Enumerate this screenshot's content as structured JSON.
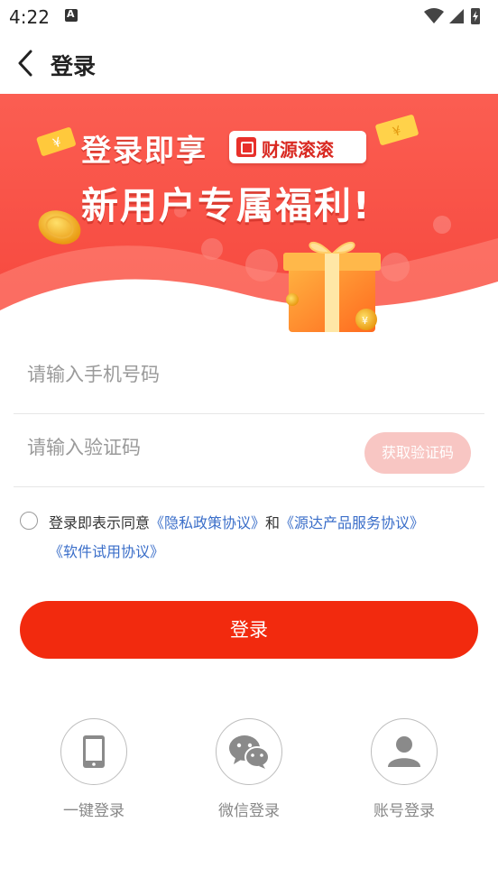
{
  "status_bar": {
    "time": "4:22",
    "icons": [
      "notification-a-icon",
      "wifi-icon",
      "signal-icon",
      "battery-charging-icon"
    ]
  },
  "header": {
    "back_icon": "chevron-left-icon",
    "title": "登录"
  },
  "banner": {
    "line1": "登录即享",
    "brand": "财源滚滚",
    "line2": "新用户专属福利!",
    "colors": {
      "top": "#fb5a4f",
      "bottom": "#f7443c"
    }
  },
  "form": {
    "phone_placeholder": "请输入手机号码",
    "code_placeholder": "请输入验证码",
    "get_code_label": "获取验证码"
  },
  "agreement": {
    "prefix": "登录即表示同意",
    "privacy_link": "《隐私政策协议》",
    "connector": "和",
    "service_link": "《源达产品服务协议》",
    "trial_link": "《软件试用协议》"
  },
  "login_button": "登录",
  "alt_logins": [
    {
      "icon": "phone-icon",
      "label": "一键登录"
    },
    {
      "icon": "wechat-icon",
      "label": "微信登录"
    },
    {
      "icon": "user-icon",
      "label": "账号登录"
    }
  ],
  "accent_color": "#f22a0e",
  "link_color": "#3a6ec9"
}
